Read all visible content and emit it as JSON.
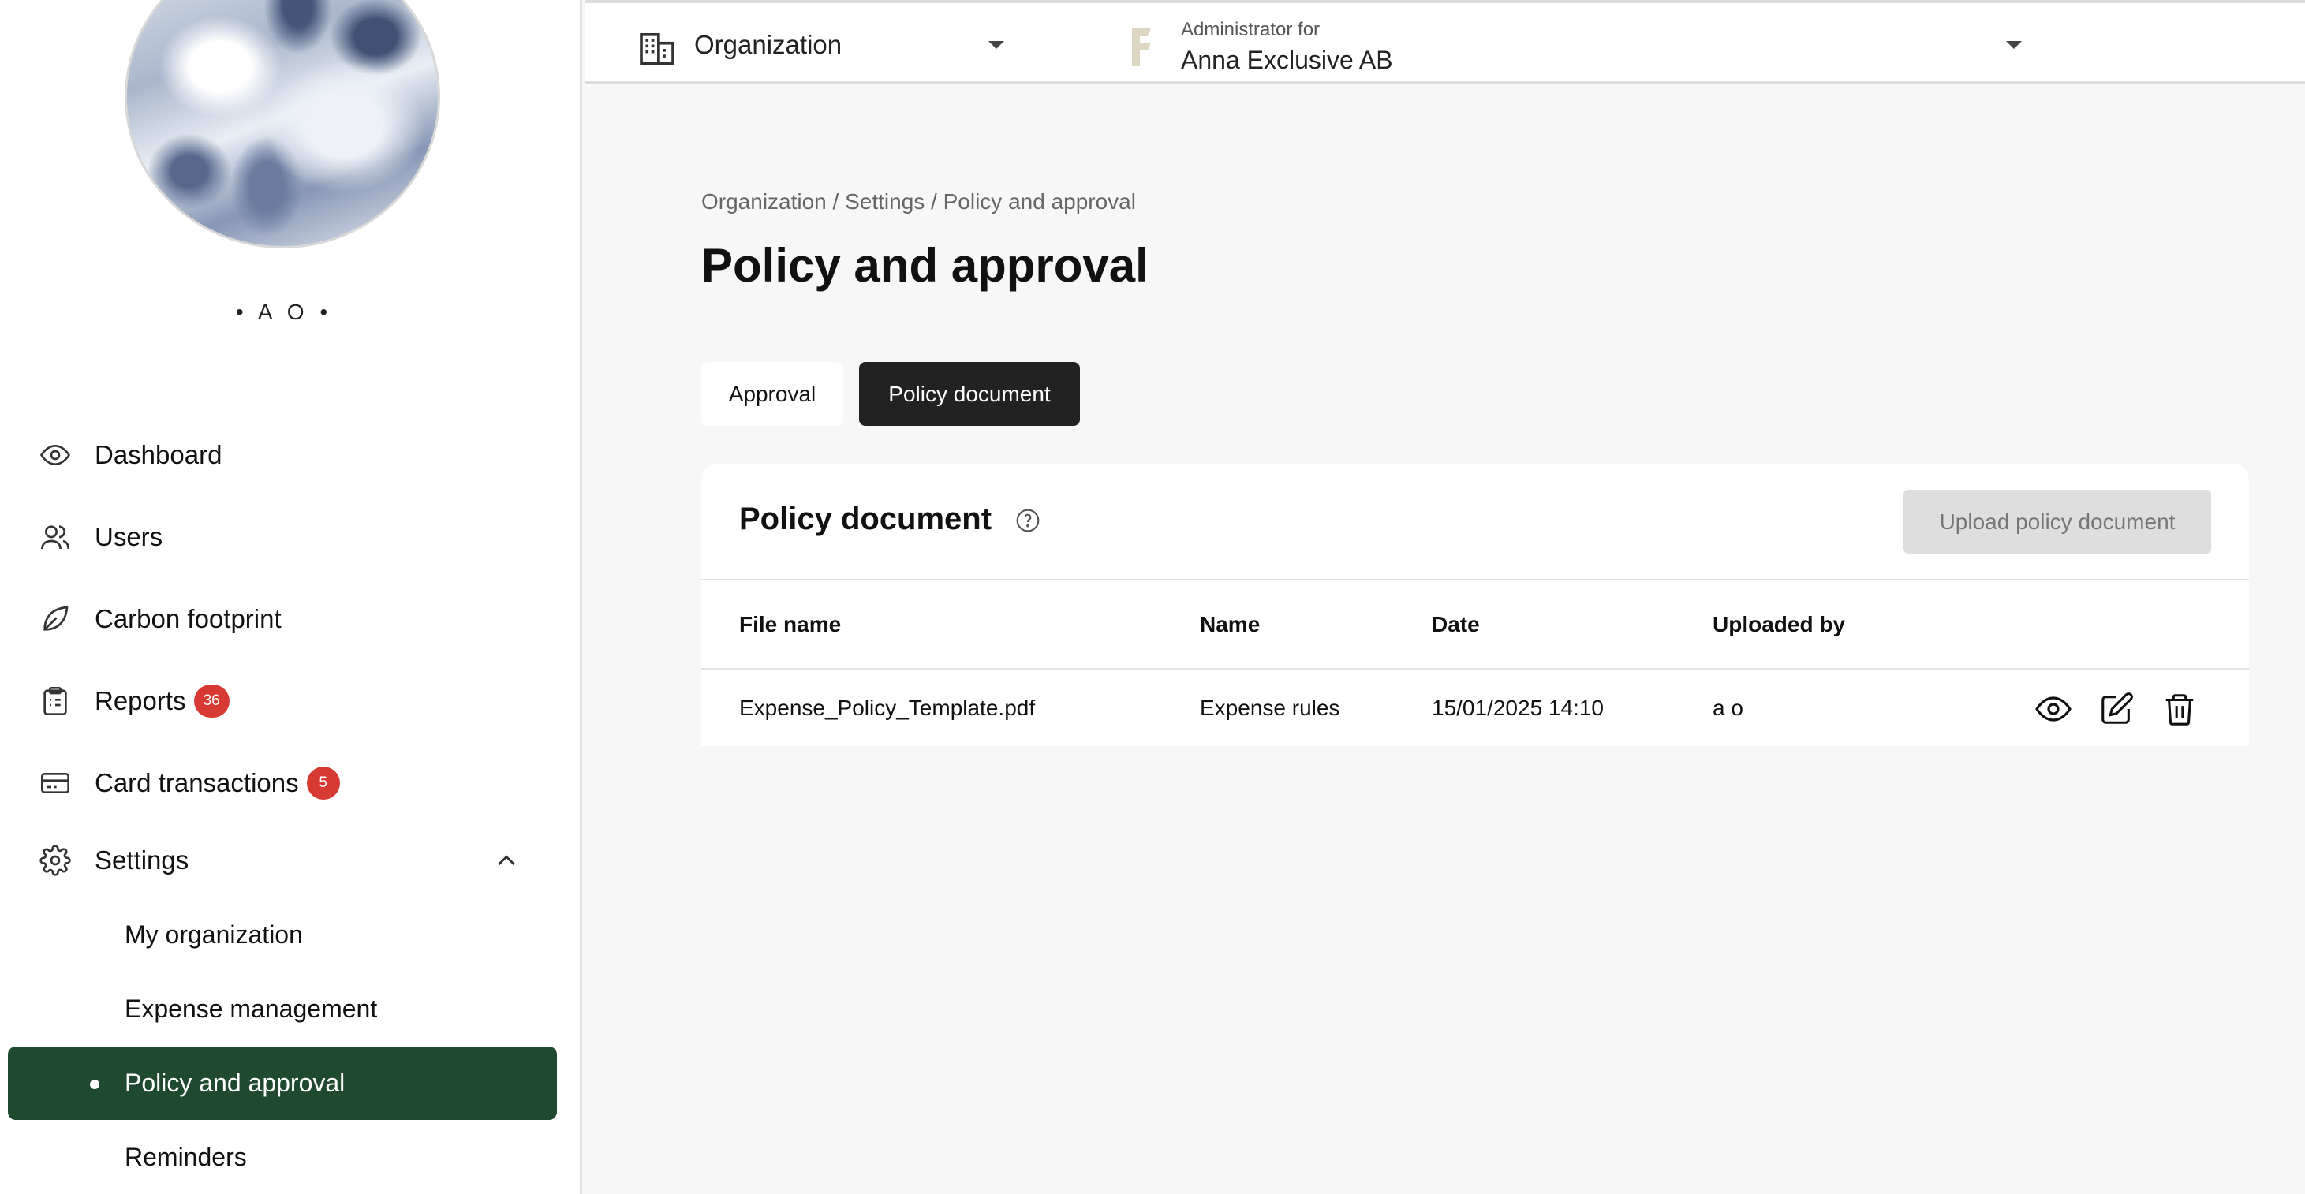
{
  "user": {
    "initials": "• A O •"
  },
  "sidebar": {
    "items": [
      {
        "label": "Dashboard",
        "icon": "eye-icon"
      },
      {
        "label": "Users",
        "icon": "users-icon"
      },
      {
        "label": "Carbon footprint",
        "icon": "leaf-icon"
      },
      {
        "label": "Reports",
        "icon": "clipboard-icon",
        "badge": "36"
      },
      {
        "label": "Card transactions",
        "icon": "credit-card-icon",
        "badge": "5"
      },
      {
        "label": "Settings",
        "icon": "gear-icon"
      }
    ],
    "settings_sub": [
      {
        "label": "My organization"
      },
      {
        "label": "Expense management"
      },
      {
        "label": "Policy and approval",
        "active": true
      },
      {
        "label": "Reminders"
      }
    ],
    "active_color": "#1f4a2f",
    "badge_color": "#d63a33"
  },
  "topbar": {
    "org_selector": "Organization",
    "admin_caption": "Administrator for",
    "admin_company": "Anna Exclusive AB"
  },
  "breadcrumb": "Organization / Settings / Policy and approval",
  "page_title": "Policy and approval",
  "tabs": [
    {
      "label": "Approval",
      "active": false
    },
    {
      "label": "Policy document",
      "active": true
    }
  ],
  "card": {
    "title": "Policy document",
    "upload_label": "Upload policy document",
    "columns": [
      "File name",
      "Name",
      "Date",
      "Uploaded by"
    ],
    "rows": [
      {
        "file_name": "Expense_Policy_Template.pdf",
        "name": "Expense rules",
        "date": "15/01/2025 14:10",
        "uploaded_by": "a o"
      }
    ]
  }
}
